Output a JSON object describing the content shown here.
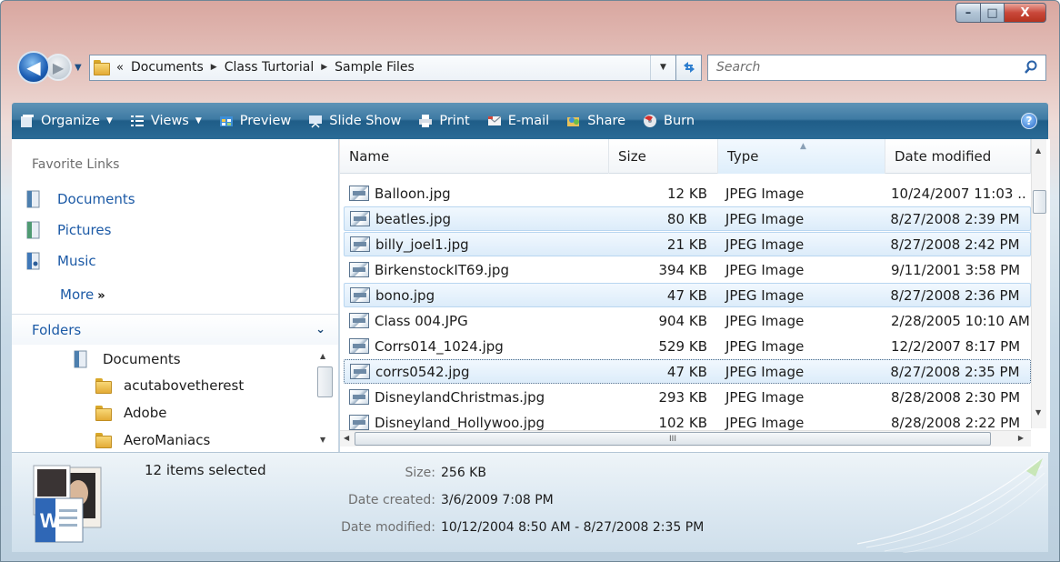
{
  "window": {
    "caption_buttons": {
      "minimize": "–",
      "maximize": "□",
      "close": "X"
    }
  },
  "address_bar": {
    "lead": "«",
    "crumbs": [
      "Documents",
      "Class Turtorial",
      "Sample Files"
    ],
    "search_placeholder": "Search"
  },
  "command_bar": {
    "items": [
      {
        "label": "Organize",
        "icon": "organize-icon",
        "dropdown": true
      },
      {
        "label": "Views",
        "icon": "views-icon",
        "dropdown": true
      },
      {
        "label": "Preview",
        "icon": "preview-icon",
        "dropdown": false
      },
      {
        "label": "Slide Show",
        "icon": "slideshow-icon",
        "dropdown": false
      },
      {
        "label": "Print",
        "icon": "printer-icon",
        "dropdown": false
      },
      {
        "label": "E-mail",
        "icon": "email-icon",
        "dropdown": false
      },
      {
        "label": "Share",
        "icon": "share-icon",
        "dropdown": false
      },
      {
        "label": "Burn",
        "icon": "burn-disc-icon",
        "dropdown": false
      }
    ],
    "help": "?"
  },
  "favorite_links": {
    "heading": "Favorite Links",
    "items": [
      "Documents",
      "Pictures",
      "Music"
    ],
    "more": "More",
    "more_glyph": "»"
  },
  "folders": {
    "heading": "Folders",
    "tree": [
      "Documents",
      "acutabovetherest",
      "Adobe",
      "AeroManiacs"
    ]
  },
  "file_list": {
    "columns": [
      "Name",
      "Size",
      "Type",
      "Date modified"
    ],
    "rows": [
      {
        "name": "Balloon.jpg",
        "size": "12 KB",
        "type": "JPEG Image",
        "date": "10/24/2007 11:03 ..",
        "selected": false
      },
      {
        "name": "beatles.jpg",
        "size": "80 KB",
        "type": "JPEG Image",
        "date": "8/27/2008 2:39 PM",
        "selected": true
      },
      {
        "name": "billy_joel1.jpg",
        "size": "21 KB",
        "type": "JPEG Image",
        "date": "8/27/2008 2:42 PM",
        "selected": true
      },
      {
        "name": "BirkenstockIT69.jpg",
        "size": "394 KB",
        "type": "JPEG Image",
        "date": "9/11/2001 3:58 PM",
        "selected": false
      },
      {
        "name": "bono.jpg",
        "size": "47 KB",
        "type": "JPEG Image",
        "date": "8/27/2008 2:36 PM",
        "selected": true
      },
      {
        "name": "Class 004.JPG",
        "size": "904 KB",
        "type": "JPEG Image",
        "date": "2/28/2005 10:10 AM",
        "selected": false
      },
      {
        "name": "Corrs014_1024.jpg",
        "size": "529 KB",
        "type": "JPEG Image",
        "date": "12/2/2007 8:17 PM",
        "selected": false
      },
      {
        "name": "corrs0542.jpg",
        "size": "47 KB",
        "type": "JPEG Image",
        "date": "8/27/2008 2:35 PM",
        "selected": true
      },
      {
        "name": "DisneylandChristmas.jpg",
        "size": "293 KB",
        "type": "JPEG Image",
        "date": "8/28/2008 2:30 PM",
        "selected": false
      },
      {
        "name": "Disneyland_Hollywoo.jpg",
        "size": "102 KB",
        "type": "JPEG Image",
        "date": "8/28/2008 2:22 PM",
        "selected": false
      }
    ],
    "hscroll_grip": "III"
  },
  "details_pane": {
    "count": "12 items selected",
    "fields": [
      {
        "label": "Size:",
        "value": "256 KB"
      },
      {
        "label": "Date created:",
        "value": "3/6/2009 7:08 PM"
      },
      {
        "label": "Date modified:",
        "value": "10/12/2004 8:50 AM - 8/27/2008 2:35 PM"
      }
    ]
  },
  "colors": {
    "command_bar": "#2a6b96",
    "link_blue": "#1c5aa6",
    "selection": "#dcecfa"
  }
}
